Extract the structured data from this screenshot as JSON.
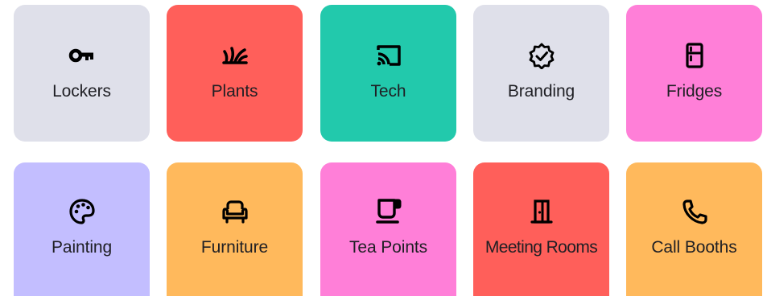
{
  "tiles": [
    {
      "label": "Lockers",
      "icon": "key-icon",
      "color": "#dfe0ea"
    },
    {
      "label": "Plants",
      "icon": "plant-icon",
      "color": "#ff5f5a"
    },
    {
      "label": "Tech",
      "icon": "cast-icon",
      "color": "#22c9ac"
    },
    {
      "label": "Branding",
      "icon": "verified-badge-icon",
      "color": "#dfe0ea"
    },
    {
      "label": "Fridges",
      "icon": "fridge-icon",
      "color": "#ff7fd8"
    },
    {
      "label": "Painting",
      "icon": "palette-icon",
      "color": "#c3beff"
    },
    {
      "label": "Furniture",
      "icon": "armchair-icon",
      "color": "#ffb95c"
    },
    {
      "label": "Tea Points",
      "icon": "cup-icon",
      "color": "#ff7fd8"
    },
    {
      "label": "Meeting Rooms",
      "icon": "door-icon",
      "color": "#ff5f5a"
    },
    {
      "label": "Call Booths",
      "icon": "phone-icon",
      "color": "#ffb95c"
    }
  ]
}
